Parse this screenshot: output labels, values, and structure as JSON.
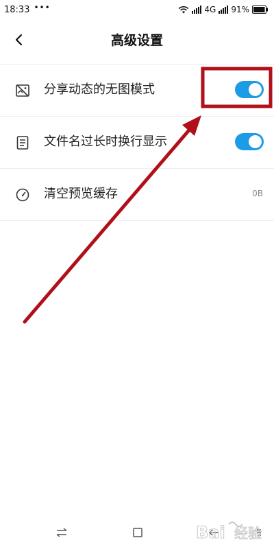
{
  "status_bar": {
    "time": "18:33",
    "dots": "•••",
    "network": "4G",
    "battery": "91%"
  },
  "header": {
    "title": "高级设置"
  },
  "settings": {
    "items": [
      {
        "label": "分享动态的无图模式",
        "icon": "no-image-icon",
        "toggle_on": true
      },
      {
        "label": "文件名过长时换行显示",
        "icon": "document-icon",
        "toggle_on": true
      },
      {
        "label": "清空预览缓存",
        "icon": "gauge-icon",
        "value": "0B"
      }
    ]
  },
  "colors": {
    "toggle_on": "#1c9be6",
    "annotation": "#b0101a"
  },
  "watermark": {
    "text": "Bai 经验"
  }
}
